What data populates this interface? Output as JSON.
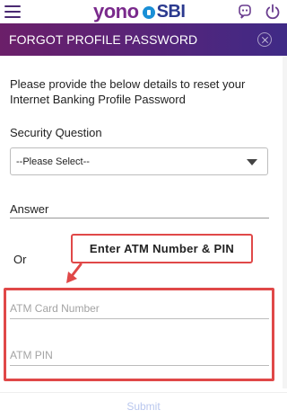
{
  "header": {
    "logo_yono": "yono",
    "logo_sbi": "SBI",
    "title": "FORGOT PROFILE PASSWORD"
  },
  "form": {
    "instructions": "Please provide the below details to reset your Internet Banking Profile Password",
    "security_question_label": "Security Question",
    "security_question_value": "--Please Select--",
    "answer_label": "Answer",
    "or_label": "Or",
    "atm_card_placeholder": "ATM Card Number",
    "atm_pin_placeholder": "ATM PIN",
    "submit_label": "Submit"
  },
  "annotation": {
    "callout_text": "Enter ATM Number & PIN"
  },
  "icons": {
    "menu": "hamburger-icon",
    "assistant": "assistant-icon",
    "power": "power-icon",
    "close": "close-icon",
    "dropdown": "chevron-down-icon"
  },
  "colors": {
    "header_gradient_start": "#6b1f69",
    "header_gradient_end": "#3f2a86",
    "annotation_red": "#e04848",
    "submit_disabled": "#b9c7ee"
  }
}
